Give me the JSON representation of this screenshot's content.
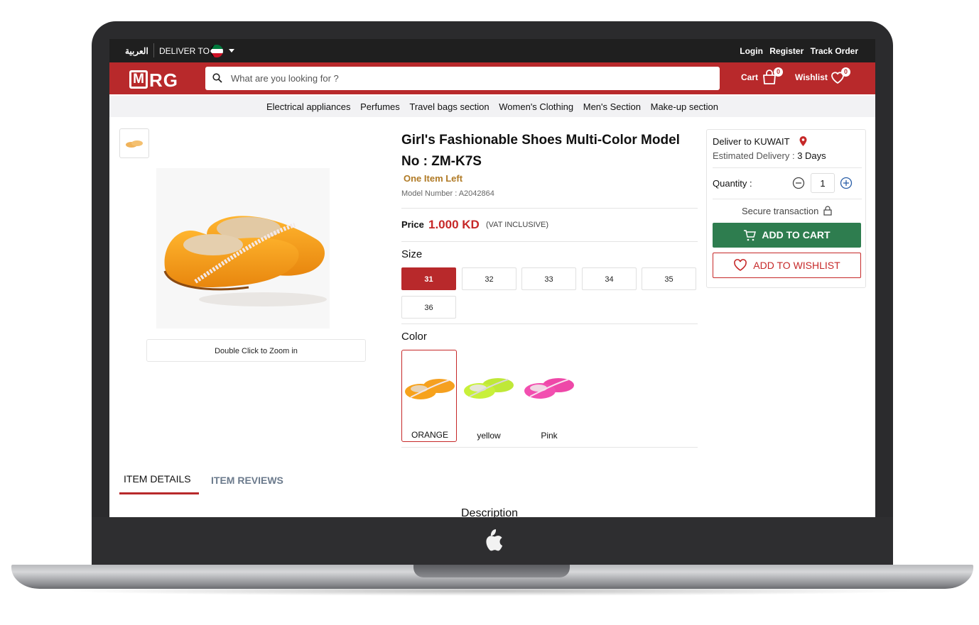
{
  "topbar": {
    "lang_label": "العربية",
    "deliver_label": "DELIVER TO",
    "links": [
      "Login",
      "Register",
      "Track Order"
    ]
  },
  "header": {
    "logo_m": "M",
    "logo_rg": "RG",
    "search_placeholder": "What are you looking for ?",
    "cart_label": "Cart",
    "cart_count": "0",
    "wishlist_label": "Wishlist",
    "wishlist_count": "0"
  },
  "nav": {
    "items": [
      "Electrical appliances",
      "Perfumes",
      "Travel bags section",
      "Women's Clothing",
      "Men's Section",
      "Make-up section"
    ]
  },
  "product": {
    "title": "Girl's Fashionable Shoes Multi-Color Model No : ZM-K7S",
    "stock": "One Item Left",
    "model": "Model Number : A2042864",
    "price_label": "Price",
    "price": "1.000 KD",
    "vat": "(VAT INCLUSIVE)",
    "zoom_hint": "Double Click to Zoom in",
    "size_label": "Size",
    "sizes": [
      "31",
      "32",
      "33",
      "34",
      "35",
      "36"
    ],
    "selected_size": "31",
    "color_label": "Color",
    "colors": [
      {
        "name": "ORANGE",
        "hex": "#f7a21b"
      },
      {
        "name": "yellow",
        "hex": "#c8f03a"
      },
      {
        "name": "Pink",
        "hex": "#f24fb0"
      }
    ],
    "selected_color": "ORANGE"
  },
  "tabs": {
    "details": "ITEM DETAILS",
    "reviews": "ITEM REVIEWS",
    "active": "ITEM DETAILS"
  },
  "description_heading": "Description",
  "panel": {
    "deliver_to": "Deliver to KUWAIT",
    "est_label": "Estimated Delivery : ",
    "est_value": "3 Days",
    "qty_label": "Quantity :",
    "qty_value": "1",
    "secure": "Secure transaction",
    "add_to_cart": "ADD TO CART",
    "add_to_wishlist": "ADD TO WISHLIST"
  },
  "colors": {
    "brand_red": "#b8292b",
    "cart_green": "#2e7d4f",
    "stock_orange": "#b07a25"
  }
}
